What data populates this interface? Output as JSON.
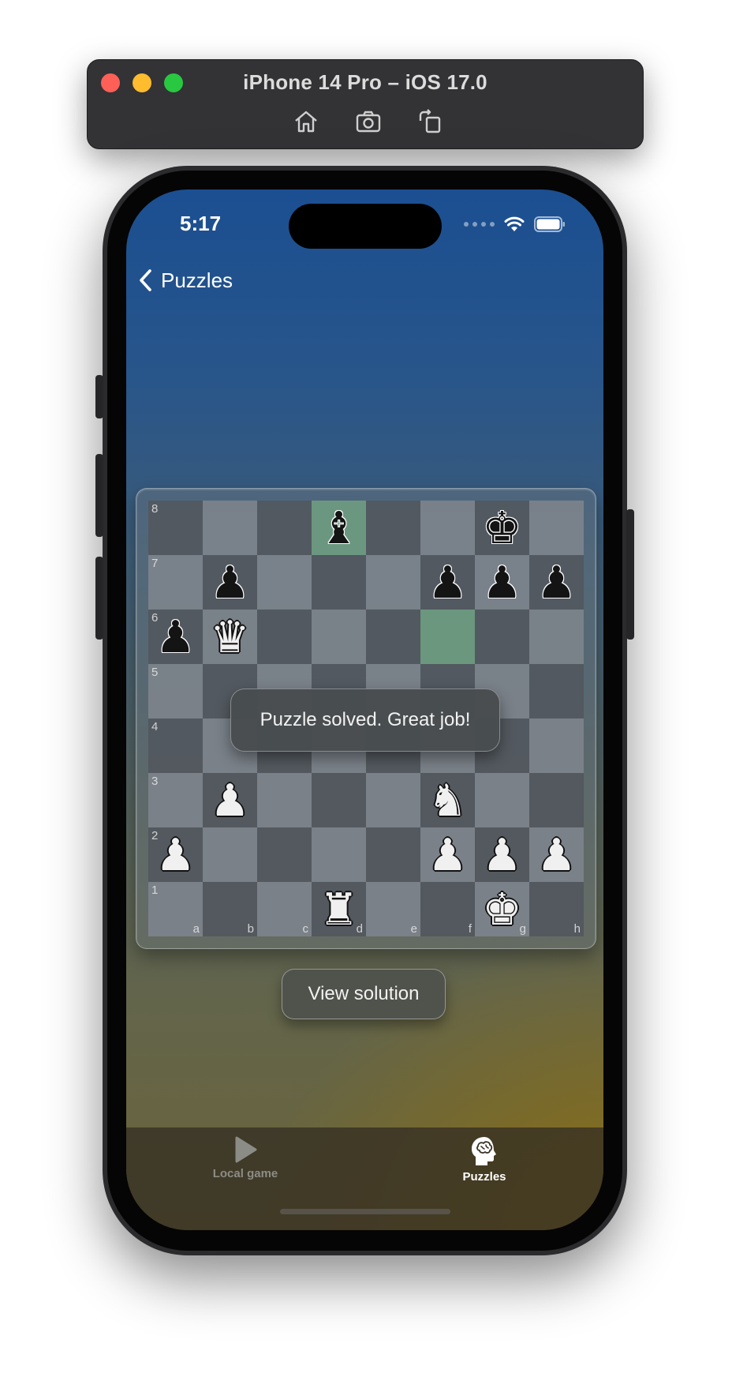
{
  "simulator": {
    "title": "iPhone 14 Pro – iOS 17.0",
    "tools": [
      "home-icon",
      "screenshot-icon",
      "rotate-icon"
    ]
  },
  "status_bar": {
    "time": "5:17",
    "icons": [
      "cellular-dots-icon",
      "wifi-icon",
      "battery-icon"
    ]
  },
  "nav": {
    "back_label": "Puzzles"
  },
  "board": {
    "ranks": [
      "8",
      "7",
      "6",
      "5",
      "4",
      "3",
      "2",
      "1"
    ],
    "files": [
      "a",
      "b",
      "c",
      "d",
      "e",
      "f",
      "g",
      "h"
    ],
    "highlighted_squares": [
      "d8",
      "f6"
    ],
    "pieces": [
      {
        "square": "d8",
        "type": "bishop",
        "color": "black",
        "glyph": "♝"
      },
      {
        "square": "g8",
        "type": "king",
        "color": "black",
        "glyph": "♚"
      },
      {
        "square": "b7",
        "type": "pawn",
        "color": "black",
        "glyph": "♟"
      },
      {
        "square": "f7",
        "type": "pawn",
        "color": "black",
        "glyph": "♟"
      },
      {
        "square": "g7",
        "type": "pawn",
        "color": "black",
        "glyph": "♟"
      },
      {
        "square": "h7",
        "type": "pawn",
        "color": "black",
        "glyph": "♟"
      },
      {
        "square": "a6",
        "type": "pawn",
        "color": "black",
        "glyph": "♟"
      },
      {
        "square": "b6",
        "type": "queen",
        "color": "white",
        "glyph": "♛"
      },
      {
        "square": "b3",
        "type": "pawn",
        "color": "white",
        "glyph": "♟"
      },
      {
        "square": "f3",
        "type": "knight",
        "color": "white",
        "glyph": "♞"
      },
      {
        "square": "a2",
        "type": "pawn",
        "color": "white",
        "glyph": "♟"
      },
      {
        "square": "f2",
        "type": "pawn",
        "color": "white",
        "glyph": "♟"
      },
      {
        "square": "g2",
        "type": "pawn",
        "color": "white",
        "glyph": "♟"
      },
      {
        "square": "h2",
        "type": "pawn",
        "color": "white",
        "glyph": "♟"
      },
      {
        "square": "d1",
        "type": "rook",
        "color": "white",
        "glyph": "♜"
      },
      {
        "square": "g1",
        "type": "king",
        "color": "white",
        "glyph": "♚"
      }
    ]
  },
  "toast": {
    "message": "Puzzle solved. Great job!"
  },
  "actions": {
    "view_solution_label": "View solution"
  },
  "tabbar": {
    "tabs": [
      {
        "label": "Local game",
        "icon": "play-icon",
        "active": false
      },
      {
        "label": "Puzzles",
        "icon": "brain-head-icon",
        "active": true
      }
    ]
  },
  "colors": {
    "highlight_square": "#6e9b80",
    "tab_active": "#ffffff",
    "tab_inactive": "#8c8c86"
  }
}
